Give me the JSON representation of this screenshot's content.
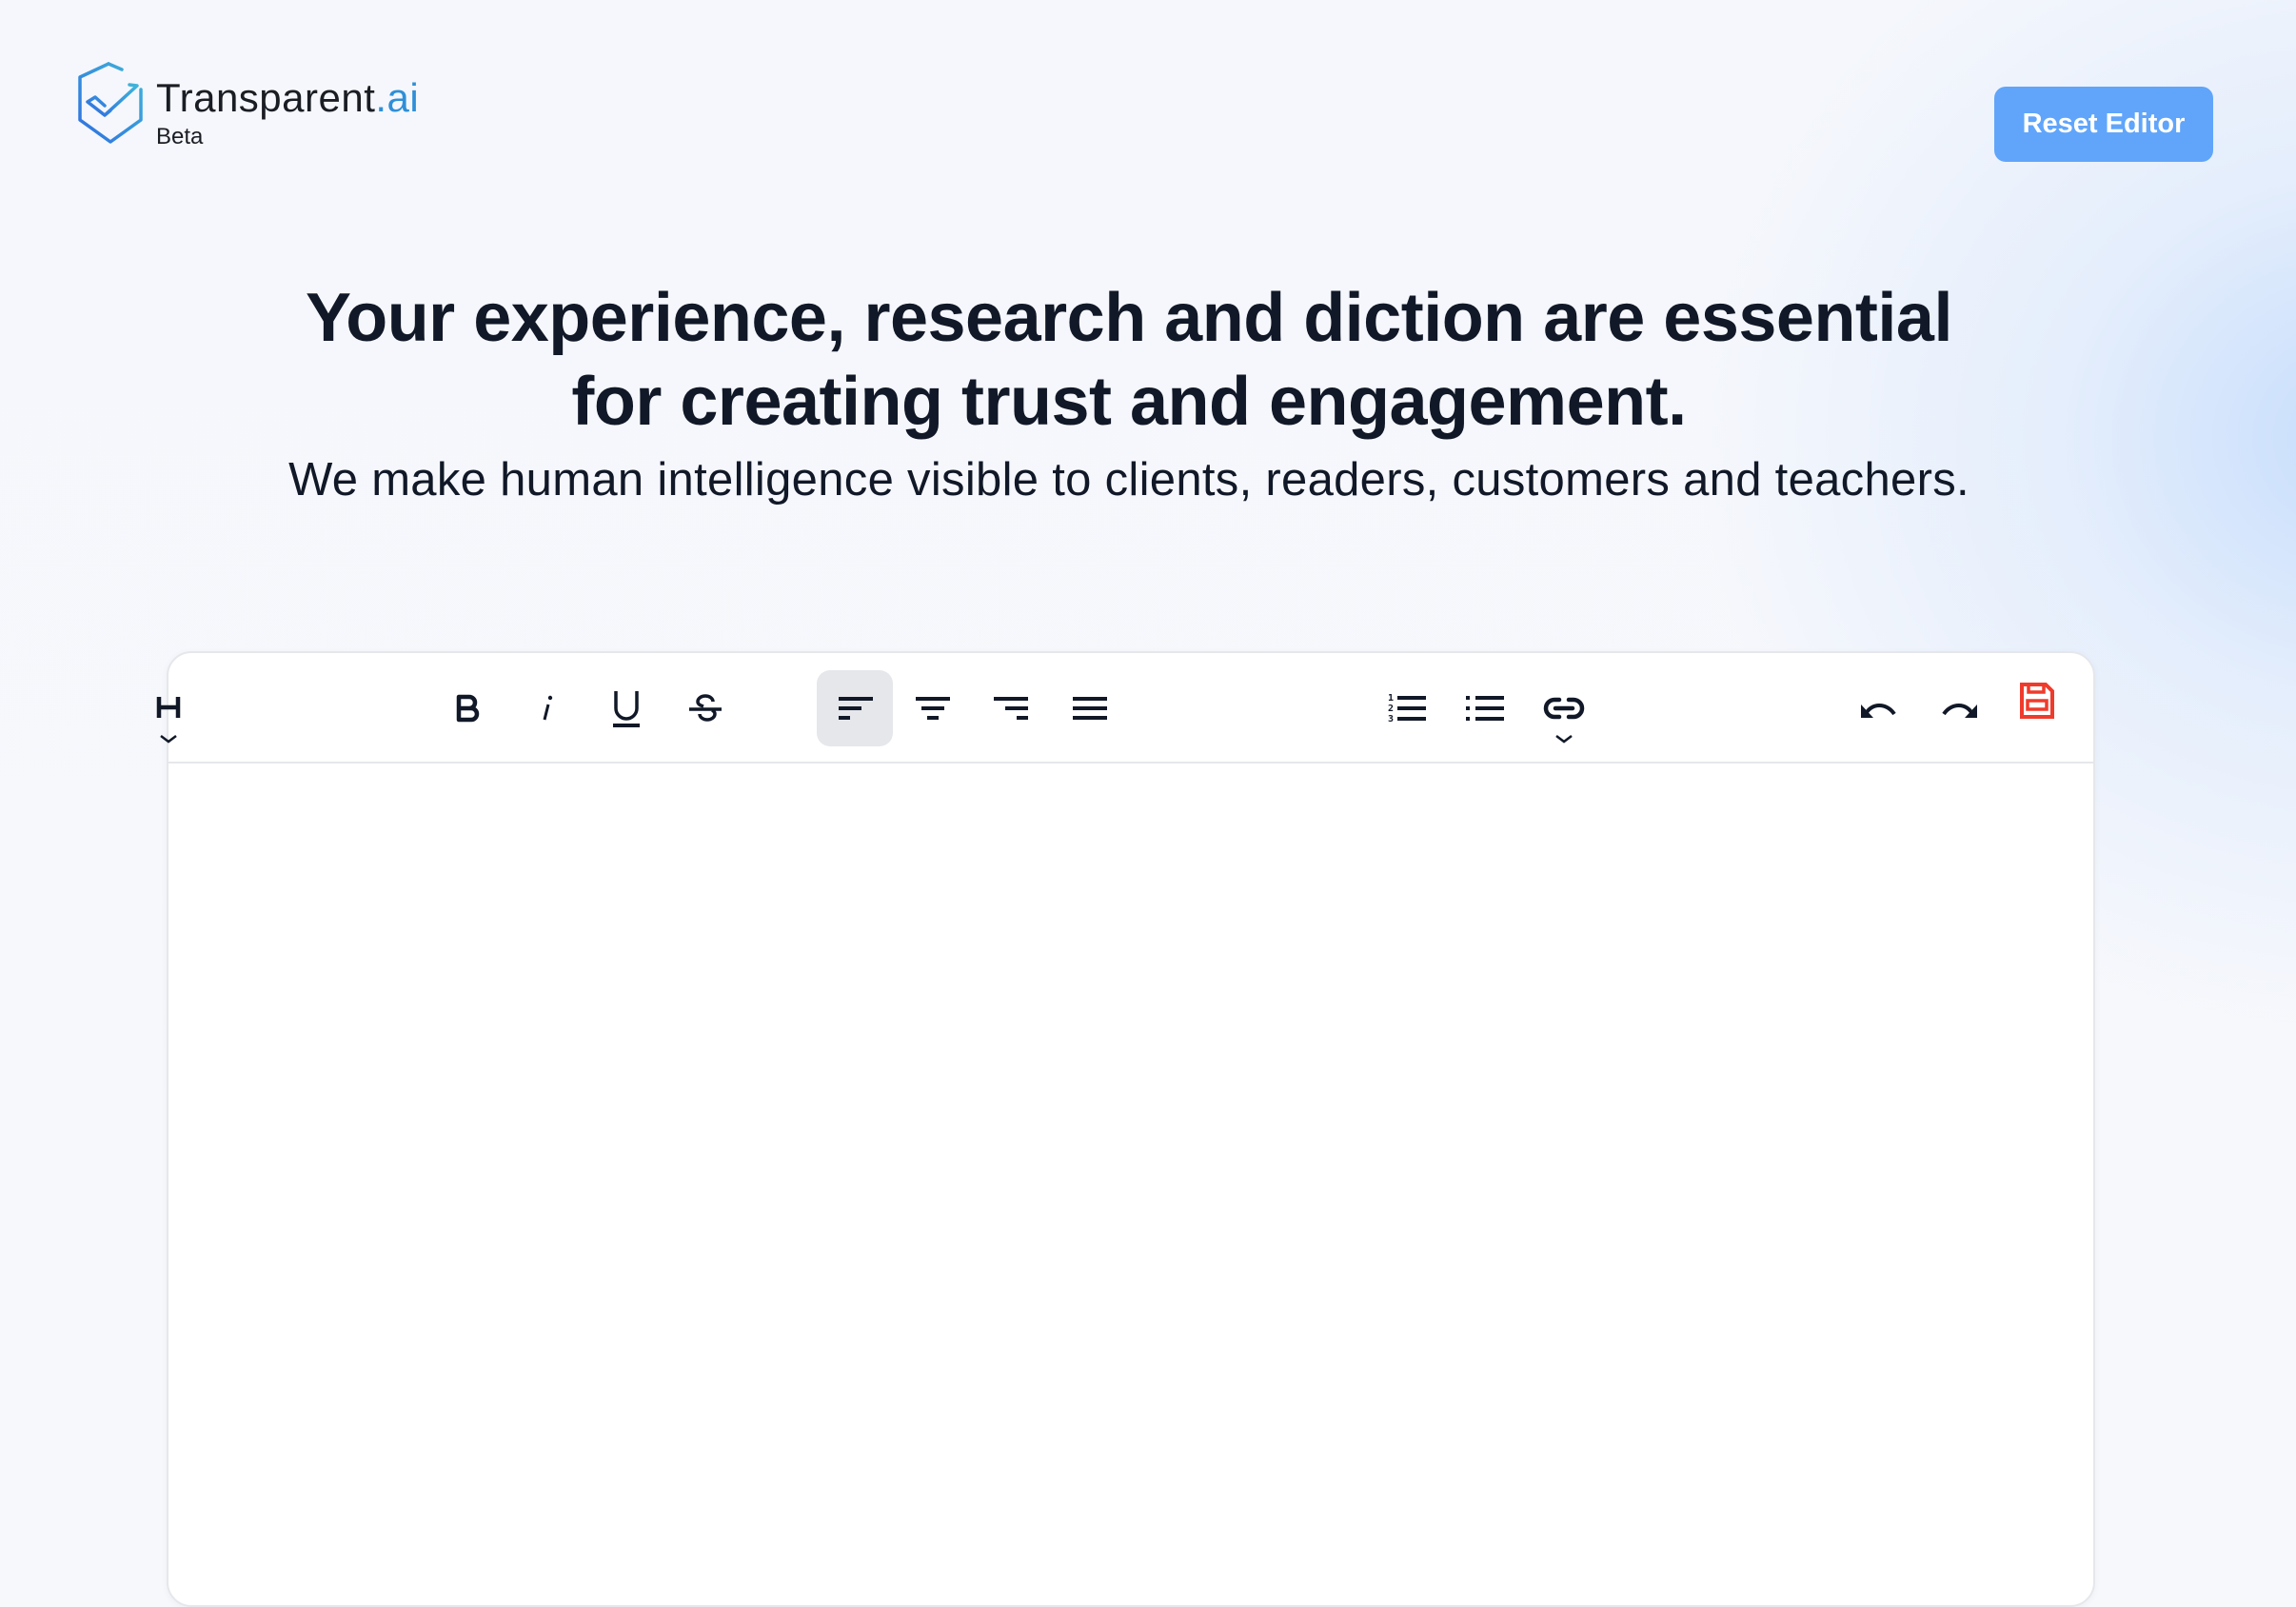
{
  "header": {
    "brand_name": "Transparent",
    "brand_suffix": ".ai",
    "badge": "Beta",
    "reset_button": "Reset Editor",
    "logo_icon": "shield-check-icon"
  },
  "hero": {
    "title_line1": "Your experience, research and diction are essential",
    "title_line2": "for creating trust and engagement.",
    "subtitle": "We make human intelligence visible to clients, readers, customers and teachers."
  },
  "editor": {
    "content": "",
    "toolbar": {
      "groups": [
        {
          "name": "text-format",
          "items": [
            "heading-dropdown",
            "bold",
            "italic",
            "underline",
            "strikethrough"
          ]
        },
        {
          "name": "alignment",
          "items": [
            "align-left",
            "align-center",
            "align-right",
            "align-justify"
          ],
          "active": "align-left"
        },
        {
          "name": "lists-links",
          "items": [
            "ordered-list",
            "bullet-list",
            "link-dropdown"
          ]
        },
        {
          "name": "history",
          "items": [
            "undo",
            "redo",
            "save"
          ]
        }
      ],
      "heading_glyph": "H",
      "bold_glyph": "B",
      "italic_glyph": "i",
      "underline_glyph": "U",
      "strike_glyph": "S"
    }
  },
  "colors": {
    "accent": "#60a5fa",
    "brand_ai": "#2f8fd8",
    "text": "#111827",
    "save_icon": "#ef3b2c",
    "active_bg": "#e5e7eb"
  }
}
